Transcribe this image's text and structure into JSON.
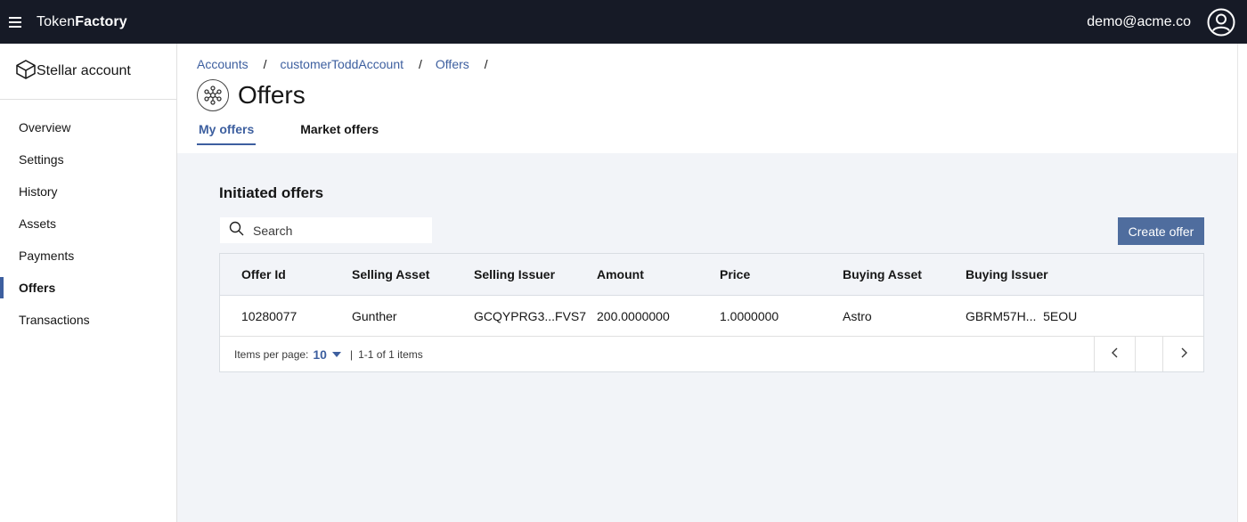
{
  "app": {
    "brand_prefix": "Token",
    "brand_suffix": "Factory",
    "user_email": "demo@acme.co"
  },
  "sidebar": {
    "title": "Stellar account",
    "items": [
      {
        "label": "Overview",
        "active": false
      },
      {
        "label": "Settings",
        "active": false
      },
      {
        "label": "History",
        "active": false
      },
      {
        "label": "Assets",
        "active": false
      },
      {
        "label": "Payments",
        "active": false
      },
      {
        "label": "Offers",
        "active": true
      },
      {
        "label": "Transactions",
        "active": false
      }
    ]
  },
  "breadcrumb": [
    "Accounts",
    "customerToddAccount",
    "Offers"
  ],
  "breadcrumb_sep": "/",
  "page": {
    "title": "Offers"
  },
  "tabs": [
    {
      "label": "My offers",
      "active": true
    },
    {
      "label": "Market offers",
      "active": false
    }
  ],
  "section": {
    "title": "Initiated offers"
  },
  "search": {
    "placeholder": "Search",
    "value": ""
  },
  "create_button": "Create offer",
  "table": {
    "columns": [
      "Offer Id",
      "Selling Asset",
      "Selling Issuer",
      "Amount",
      "Price",
      "Buying Asset",
      "Buying Issuer"
    ],
    "rows": [
      [
        "10280077",
        "Gunther",
        "GCQYPRG3...FVS7",
        "200.0000000",
        "1.0000000",
        "Astro",
        "GBRM57H...  5EOU"
      ]
    ]
  },
  "pagination": {
    "items_per_page_label": "Items per page:",
    "items_per_page": "10",
    "divider": "|",
    "range_text": "1-1 of 1 items"
  },
  "colors": {
    "topbar": "#161a26",
    "accent": "#3d5f9f",
    "button": "#4f6d9e",
    "content_bg": "#f2f4f8"
  }
}
